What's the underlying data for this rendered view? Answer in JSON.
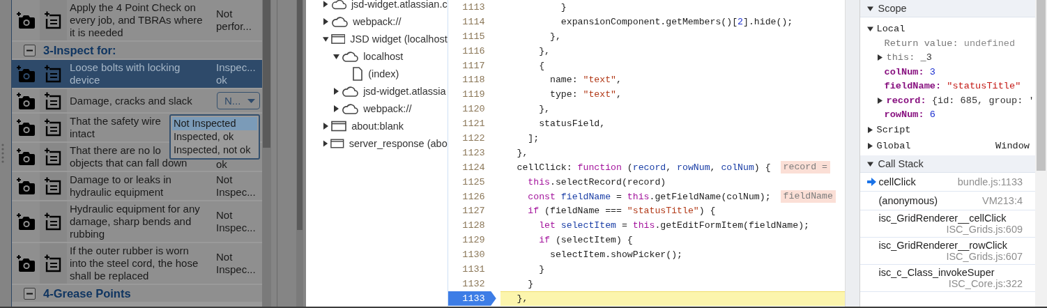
{
  "checklist": {
    "rows": [
      {
        "kind": "item",
        "selected": false,
        "lines": [
          "Apply the 4 Point Check on",
          "every job, and TBRAs where",
          "it is needed"
        ],
        "status": [
          "Not",
          "perfor..."
        ]
      },
      {
        "kind": "group",
        "label": "3-Inspect for:",
        "expanded": true
      },
      {
        "kind": "item",
        "selected": true,
        "lines": [
          "Loose bolts with locking",
          "device"
        ],
        "status": [
          "Inspec...",
          "ok"
        ]
      },
      {
        "kind": "item",
        "selected": false,
        "lines": [
          "Damage, cracks and slack"
        ],
        "picker": {
          "value": "N..."
        }
      },
      {
        "kind": "item",
        "selected": false,
        "lines": [
          "That the safety wire",
          "intact"
        ]
      },
      {
        "kind": "item",
        "selected": false,
        "lines": [
          "That there are no lo",
          "objects that can fall down"
        ],
        "status": [
          "ok"
        ]
      },
      {
        "kind": "item",
        "selected": false,
        "lines": [
          "Damage to or leaks in",
          "hydraulic equipment"
        ],
        "status": [
          "Not",
          "Inspec..."
        ]
      },
      {
        "kind": "item",
        "selected": false,
        "lines": [
          "Hydraulic equipment for any",
          "damage, sharp bends and",
          "rubbing"
        ],
        "status": [
          "Not",
          "Inspec..."
        ]
      },
      {
        "kind": "item",
        "selected": false,
        "lines": [
          "If the outer rubber is worn",
          "into the steel cord, the hose",
          "shall be replaced"
        ],
        "status": [
          "Not",
          "Inspec..."
        ]
      },
      {
        "kind": "group",
        "label": "4-Grease Points",
        "expanded": true
      }
    ]
  },
  "picker_menu": {
    "options": [
      {
        "label": "Not Inspected",
        "selected": true
      },
      {
        "label": "Inspected, ok",
        "selected": false
      },
      {
        "label": "Inspected, not ok",
        "selected": false
      }
    ]
  },
  "file_tree": {
    "items": [
      {
        "label": "jsd-widget.atlassian.c",
        "kind": "cloud",
        "expanded": false
      },
      {
        "label": "webpack://",
        "kind": "cloud",
        "expanded": false
      },
      {
        "label": "JSD widget (localhost",
        "kind": "frame",
        "expanded": true,
        "children": [
          {
            "label": "localhost",
            "kind": "cloud",
            "expanded": true,
            "children": [
              {
                "label": "(index)",
                "kind": "file"
              }
            ]
          },
          {
            "label": "jsd-widget.atlassia",
            "kind": "cloud",
            "expanded": false
          },
          {
            "label": "webpack://",
            "kind": "cloud",
            "expanded": false
          }
        ]
      },
      {
        "label": "about:blank",
        "kind": "frame",
        "expanded": false
      },
      {
        "label": "server_response (abo",
        "kind": "frame",
        "expanded": false
      }
    ]
  },
  "source": {
    "lines": [
      {
        "number": "1113",
        "current": false,
        "tokens": [
          {
            "t": "          }"
          }
        ]
      },
      {
        "number": "1114",
        "current": false,
        "tokens": [
          {
            "t": "          expansionComponent.getMembers()["
          },
          {
            "t": "2",
            "kind": "num"
          },
          {
            "t": "].hide();"
          }
        ]
      },
      {
        "number": "1115",
        "current": false,
        "tokens": [
          {
            "t": "        },"
          }
        ]
      },
      {
        "number": "1116",
        "current": false,
        "tokens": [
          {
            "t": "      },"
          }
        ]
      },
      {
        "number": "1117",
        "current": false,
        "tokens": [
          {
            "t": "      {"
          }
        ]
      },
      {
        "number": "1118",
        "current": false,
        "tokens": [
          {
            "t": "        name: "
          },
          {
            "t": "\"text\"",
            "kind": "str"
          },
          {
            "t": ","
          }
        ]
      },
      {
        "number": "1119",
        "current": false,
        "tokens": [
          {
            "t": "        type: "
          },
          {
            "t": "\"text\"",
            "kind": "str"
          },
          {
            "t": ","
          }
        ]
      },
      {
        "number": "1120",
        "current": false,
        "tokens": [
          {
            "t": "      },"
          }
        ]
      },
      {
        "number": "1121",
        "current": false,
        "tokens": [
          {
            "t": "      statusField,"
          }
        ]
      },
      {
        "number": "1122",
        "current": false,
        "tokens": [
          {
            "t": "    ];"
          }
        ]
      },
      {
        "number": "1123",
        "current": false,
        "tokens": [
          {
            "t": "  },"
          }
        ]
      },
      {
        "number": "1124",
        "current": false,
        "tokens": [
          {
            "t": "  cellClick: "
          },
          {
            "t": "function",
            "kind": "kw"
          },
          {
            "t": " ("
          },
          {
            "t": "record",
            "kind": "def"
          },
          {
            "t": ", "
          },
          {
            "t": "rowNum",
            "kind": "def"
          },
          {
            "t": ", "
          },
          {
            "t": "colNum",
            "kind": "def"
          },
          {
            "t": ") {"
          }
        ],
        "hint": "record ="
      },
      {
        "number": "1125",
        "current": false,
        "tokens": [
          {
            "t": "    this",
            "kind": "kw"
          },
          {
            "t": ".selectRecord(record)"
          }
        ]
      },
      {
        "number": "1126",
        "current": false,
        "tokens": [
          {
            "t": "    const",
            "kind": "kw"
          },
          {
            "t": " fieldName",
            "kind": "def"
          },
          {
            "t": " = "
          },
          {
            "t": "this",
            "kind": "kw"
          },
          {
            "t": ".getFieldName(colNum);"
          }
        ],
        "hint": "fieldName"
      },
      {
        "number": "1127",
        "current": false,
        "tokens": [
          {
            "t": "    if",
            "kind": "kw"
          },
          {
            "t": " (fieldName === "
          },
          {
            "t": "\"statusTitle\"",
            "kind": "str"
          },
          {
            "t": ") {"
          }
        ]
      },
      {
        "number": "1128",
        "current": false,
        "tokens": [
          {
            "t": "      let",
            "kind": "kw"
          },
          {
            "t": " selectItem",
            "kind": "def"
          },
          {
            "t": " = "
          },
          {
            "t": "this",
            "kind": "kw"
          },
          {
            "t": ".getEditFormItem(fieldName);"
          }
        ]
      },
      {
        "number": "1129",
        "current": false,
        "tokens": [
          {
            "t": "      if",
            "kind": "kw"
          },
          {
            "t": " (selectItem) {"
          }
        ]
      },
      {
        "number": "1130",
        "current": false,
        "tokens": [
          {
            "t": "        selectItem.showPicker();"
          }
        ]
      },
      {
        "number": "1131",
        "current": false,
        "tokens": [
          {
            "t": "      }"
          }
        ]
      },
      {
        "number": "1132",
        "current": false,
        "tokens": [
          {
            "t": "    }"
          }
        ]
      },
      {
        "number": "1133",
        "current": true,
        "tokens": [
          {
            "t": "  },"
          }
        ]
      }
    ]
  },
  "scope": {
    "title": "Scope",
    "expanded": true,
    "groups": [
      {
        "label": "Local",
        "expanded": true,
        "vars": [
          {
            "name": "Return value:",
            "value": {
              "text": "undefined",
              "kind": "undefined"
            },
            "kind": "return"
          },
          {
            "name": "this:",
            "value": {
              "text": "_3",
              "kind": "object"
            },
            "kind": "internal",
            "expanded": false
          },
          {
            "name": "colNum:",
            "value": {
              "text": "3",
              "kind": "number"
            },
            "kind": "var"
          },
          {
            "name": "fieldName:",
            "value": {
              "text": "\"statusTitle\"",
              "kind": "string"
            },
            "kind": "var"
          },
          {
            "name": "record:",
            "value": {
              "text": "{id: 685, group: '",
              "kind": "object"
            },
            "kind": "var",
            "expanded": false
          },
          {
            "name": "rowNum:",
            "value": {
              "text": "6",
              "kind": "number"
            },
            "kind": "var"
          }
        ]
      },
      {
        "label": "Script",
        "expanded": false
      },
      {
        "label": "Global",
        "expanded": false,
        "value": "Window"
      }
    ]
  },
  "call_stack": {
    "title": "Call Stack",
    "expanded": true,
    "frames": [
      {
        "name": "cellClick",
        "location": "bundle.js:1133",
        "selected": true
      },
      {
        "name": "(anonymous)",
        "location": "VM213:4",
        "selected": false
      },
      {
        "name": "isc_GridRenderer__cellClick",
        "location": "ISC_Grids.js:609",
        "selected": false
      },
      {
        "name": "isc_GridRenderer__rowClick",
        "location": "ISC_Grids.js:607",
        "selected": false
      },
      {
        "name": "isc_c_Class_invokeSuper",
        "location": "ISC_Core.js:322",
        "selected": false
      }
    ]
  }
}
